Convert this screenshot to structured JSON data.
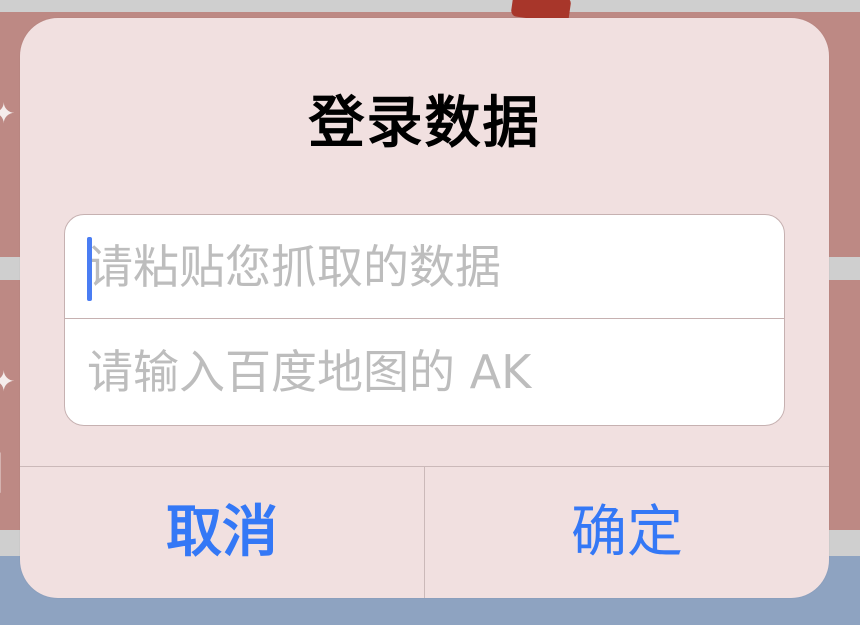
{
  "dialog": {
    "title": "登录数据",
    "fields": [
      {
        "placeholder": "请粘贴您抓取的数据",
        "value": "",
        "focused": true
      },
      {
        "placeholder": "请输入百度地图的 AK",
        "value": "",
        "focused": false
      }
    ],
    "buttons": {
      "cancel_label": "取消",
      "confirm_label": "确定"
    }
  },
  "colors": {
    "accent": "#3478f6",
    "caret": "#4a7df3",
    "dialog_background": "#f1e0e0",
    "backdrop_band": "#bd8984",
    "backdrop_bottom": "#8ea3c1"
  }
}
